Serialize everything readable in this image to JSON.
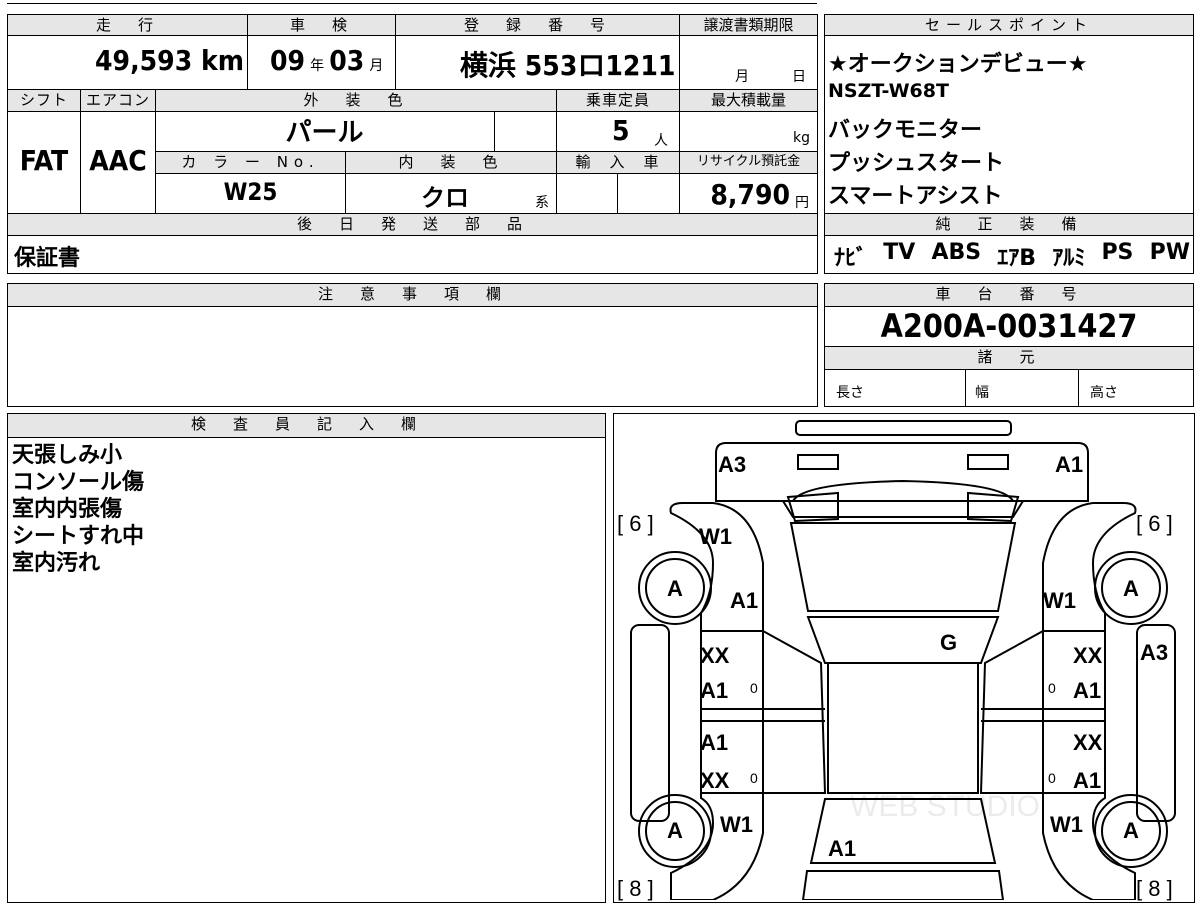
{
  "header": {
    "mileage_label": "走　行",
    "inspection_label": "車　検",
    "reg_label": "登　録　番　号",
    "doc_deadline_label": "譲渡書類期限",
    "sales_label": "セールスポイント",
    "mileage": "49,593 km",
    "inspection_year": "09",
    "inspection_year_unit": "年",
    "inspection_month": "03",
    "inspection_month_unit": "月",
    "reg_number": "横浜 553ロ1211",
    "deadline_month": "月",
    "deadline_day": "日"
  },
  "specs": {
    "shift_label": "シフト",
    "ac_label": "エアコン",
    "exterior_label": "外　装　色",
    "capacity_label": "乗車定員",
    "max_load_label": "最大積載量",
    "shift": "FAT",
    "ac": "AAC",
    "exterior": "パール",
    "capacity": "5",
    "capacity_unit": "人",
    "load_unit": "kg",
    "color_no_label": "カ ラ ー No.",
    "interior_label": "内　装　色",
    "import_label": "輸　入　車",
    "recycle_label": "リサイクル預託金",
    "color_no": "W25",
    "interior": "クロ",
    "interior_unit": "系",
    "recycle": "8,790",
    "recycle_unit": "円"
  },
  "later_parts": {
    "label": "後　日　発　送　部　品",
    "value": "保証書"
  },
  "sales_points": [
    "★オークションデビュー★",
    "NSZT-W68T",
    "バックモニター",
    "プッシュスタート",
    "スマートアシスト"
  ],
  "equipment": {
    "label": "純　正　装　備",
    "items": [
      "ﾅﾋﾞ",
      "TV",
      "ABS",
      "ｴｱB",
      "ｱﾙﾐ",
      "PS",
      "PW"
    ]
  },
  "notes": {
    "label": "注　意　事　項　欄",
    "value": ""
  },
  "chassis": {
    "label": "車　台　番　号",
    "value": "A200A-0031427",
    "dims_label": "諸　元",
    "length_label": "長さ",
    "width_label": "幅",
    "height_label": "高さ"
  },
  "inspector": {
    "label": "検　査　員　記　入　欄",
    "lines": [
      "天張しみ小",
      "コンソール傷",
      "室内内張傷",
      "シートすれ中",
      "室内汚れ"
    ]
  },
  "diagram": {
    "marks": [
      "A3",
      "A1",
      "[ 6 ]",
      "[ 6 ]",
      "W1",
      "W1",
      "A",
      "A",
      "A1",
      "A1",
      "G",
      "A3",
      "XX",
      "A1",
      "XX",
      "A1",
      "A1",
      "XX",
      "XX",
      "A1",
      "A",
      "A",
      "W1",
      "W1",
      "A1",
      "[ 8 ]",
      "[ 8 ]",
      "0",
      "0",
      "0",
      "0"
    ],
    "watermark": "WEB STUDIO"
  }
}
